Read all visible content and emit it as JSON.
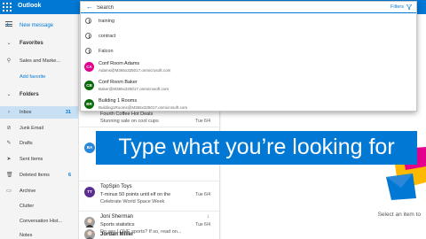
{
  "app": {
    "title": "Outlook"
  },
  "nav": {
    "new_message": "New message",
    "favorites_header": "Favorites",
    "sales_item": "Sales and Marke...",
    "add_favorite": "Add favorite",
    "folders_header": "Folders",
    "folders": [
      {
        "label": "Inbox",
        "count": "31"
      },
      {
        "label": "Junk Email",
        "count": ""
      },
      {
        "label": "Drafts",
        "count": ""
      },
      {
        "label": "Sent Items",
        "count": ""
      },
      {
        "label": "Deleted Items",
        "count": "6"
      },
      {
        "label": "Archive",
        "count": ""
      },
      {
        "label": "Clutter",
        "count": ""
      },
      {
        "label": "Conversation Hist...",
        "count": ""
      },
      {
        "label": "Notes",
        "count": ""
      }
    ]
  },
  "search": {
    "placeholder": "Search",
    "filters_label": "Filters",
    "history": [
      "training",
      "contract",
      "Falcon"
    ],
    "people": [
      {
        "initials": "CA",
        "name": "Conf Room Adams",
        "email": "Adams@M365x325017.onmicrosoft.com",
        "color": "#e3008c"
      },
      {
        "initials": "CB",
        "name": "Conf Room Baker",
        "email": "Baker@M365x325017.onmicrosoft.com",
        "color": "#0b6a0b"
      },
      {
        "initials": "BR",
        "name": "Building 1 Rooms",
        "email": "Building1Rooms@M365x325017.onmicrosoft.com",
        "color": "#0b6a0b"
      }
    ]
  },
  "messages": [
    {
      "from": "",
      "subject": "Fourth Coffee Hot Deals",
      "preview": "Stunning sale on cool cups",
      "date": "Tue 6/4",
      "initials": "",
      "color": "#ffffff"
    },
    {
      "from": "",
      "subject": "",
      "preview": "",
      "date": "",
      "initials": "BA",
      "color": "#2b88d8"
    },
    {
      "from": "TopSpin Toys",
      "subject": "T-minus 50 points until elf on the",
      "preview": "Celebrate World Space Week",
      "date": "Tue 6/4",
      "initials": "TT",
      "color": "#5c2d91"
    },
    {
      "from": "Joni Sherman",
      "subject": "Sports statistics",
      "preview": "Do you LOVE sports? If so, read on...",
      "date": "Tue 6/4",
      "initials": "",
      "color": "#8a8886"
    },
    {
      "from": "Jordan Miller",
      "subject": "",
      "preview": "",
      "date": "",
      "initials": "",
      "color": "#8a8886"
    }
  ],
  "reading": {
    "empty_text": "Select an item to"
  },
  "caption": {
    "text": "Type what you’re looking for"
  }
}
